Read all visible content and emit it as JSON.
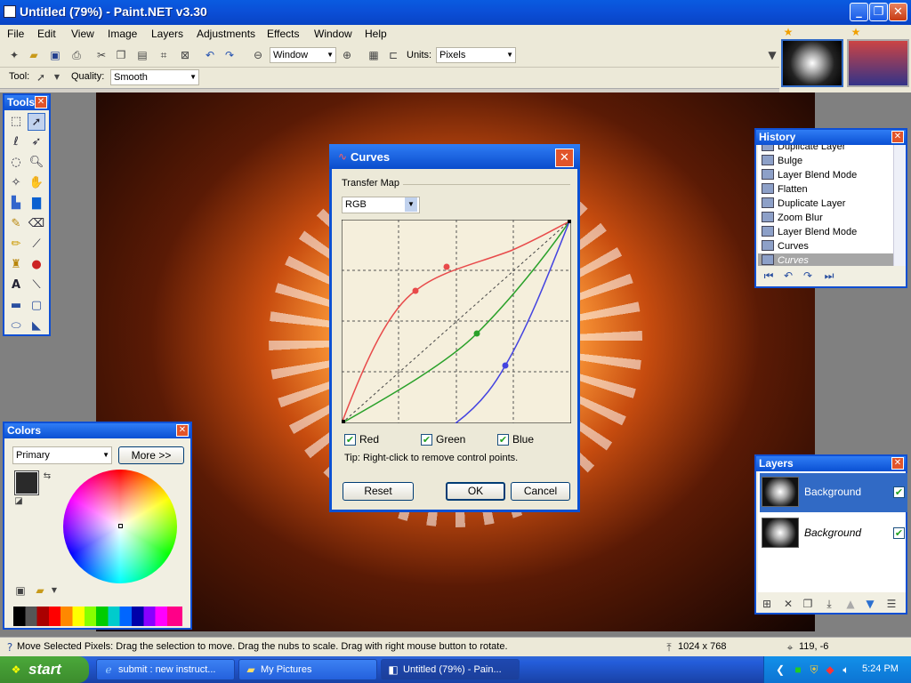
{
  "window": {
    "title": "Untitled (79%) - Paint.NET v3.30",
    "min": "_",
    "max": "❐",
    "close": "✕"
  },
  "menu": [
    "File",
    "Edit",
    "View",
    "Image",
    "Layers",
    "Adjustments",
    "Effects",
    "Window",
    "Help"
  ],
  "toolbar": {
    "zoom_mode": "Window",
    "units_label": "Units:",
    "units_value": "Pixels"
  },
  "toolbar2": {
    "tool_label": "Tool:",
    "quality_label": "Quality:",
    "quality_value": "Smooth"
  },
  "tools_panel": {
    "title": "Tools"
  },
  "history": {
    "title": "History",
    "items": [
      "Duplicate Layer",
      "Bulge",
      "Layer Blend Mode",
      "Flatten",
      "Duplicate Layer",
      "Zoom Blur",
      "Layer Blend Mode",
      "Curves",
      "Curves"
    ]
  },
  "colors": {
    "title": "Colors",
    "mode": "Primary",
    "more_label": "More >>",
    "primary": "#2a2a2a",
    "secondary": "#ffffff"
  },
  "layers": {
    "title": "Layers",
    "items": [
      "Background",
      "Background"
    ]
  },
  "curves": {
    "title": "Curves",
    "group_label": "Transfer Map",
    "mode": "RGB",
    "channels": [
      {
        "name": "Red",
        "checked": "✔"
      },
      {
        "name": "Green",
        "checked": "✔"
      },
      {
        "name": "Blue",
        "checked": "✔"
      }
    ],
    "tip": "Tip: Right-click to remove control points.",
    "reset_label": "Reset",
    "ok_label": "OK",
    "cancel_label": "Cancel",
    "colors": {
      "red": "#e84a4a",
      "green": "#2aa12a",
      "blue": "#4444e0"
    }
  },
  "status": {
    "message": "Move Selected Pixels: Drag the selection to move. Drag the nubs to scale. Drag with right mouse button to rotate.",
    "image_size": "1024 x 768",
    "cursor": "119, -6"
  },
  "taskbar": {
    "start_label": "start",
    "tasks": [
      "submit : new instruct...",
      "My Pictures",
      "Untitled (79%) - Pain..."
    ],
    "clock": "5:24 PM"
  }
}
